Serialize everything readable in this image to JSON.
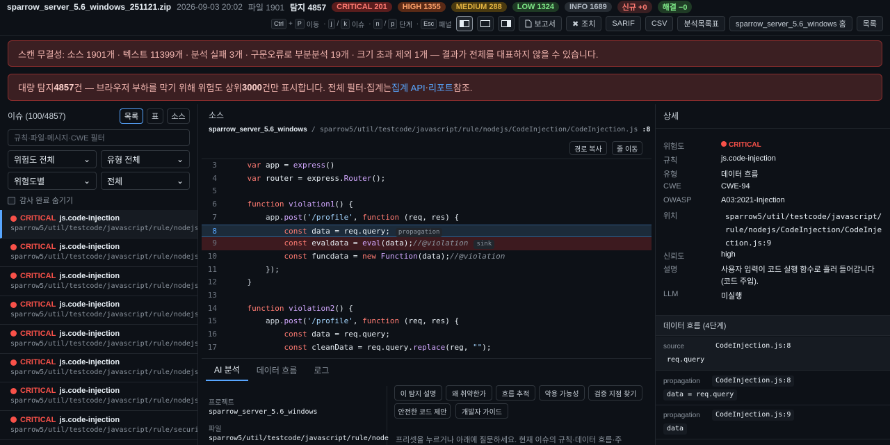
{
  "header": {
    "filename": "sparrow_server_5.6_windows_251121.zip",
    "datetime": "2026-09-03 20:02",
    "file_count_label": "파일 1901",
    "detect_label": "탐지",
    "detect_count": "4857",
    "badges": {
      "critical": "CRITICAL 201",
      "high": "HIGH 1355",
      "medium": "MEDIUM 288",
      "low": "LOW 1324",
      "info": "INFO 1689",
      "new": "신규 +0",
      "resolved": "해결 −0"
    },
    "badge_colors": {
      "critical": "#5a1d1d",
      "high": "#5a2a16",
      "medium": "#4a3a10",
      "low": "#1f3b25",
      "info": "#262c33",
      "new": "#3a1f22",
      "resolved": "#1f3b25"
    }
  },
  "toolbar": {
    "hint_nav": {
      "k1": "Ctrl",
      "plus": "+",
      "k2": "P",
      "label": "이동"
    },
    "hint_issue": {
      "k1": "j",
      "sep": "/",
      "k2": "k",
      "label": "이슈"
    },
    "hint_step": {
      "k1": "n",
      "sep": "/",
      "k2": "p",
      "label": "단계"
    },
    "hint_panel": {
      "k1": "Esc",
      "label": "패널"
    },
    "report": "보고서",
    "action": "조치",
    "sarif": "SARIF",
    "csv": "CSV",
    "analysis_list": "분석목록표",
    "project_home": "sparrow_server_5.6_windows 홈",
    "list": "목록"
  },
  "banners": {
    "integrity": "스캔 무결성: 소스 1901개 · 텍스트 11399개 · 분석 실패 3개 · 구문오류로 부분분석 19개 · 크기 초과 제외 1개 — 결과가 전체를 대표하지 않을 수 있습니다.",
    "bulk_a": "대량 탐지 ",
    "bulk_count": "4857",
    "bulk_b": "건 — 브라우저 부하를 막기 위해 위험도 상위 ",
    "bulk_top": "3000",
    "bulk_c": "건만 표시합니다. 전체 필터·집계는 ",
    "bulk_link1": "집계 API",
    "bulk_sep": " · ",
    "bulk_link2": "리포트",
    "bulk_d": " 참조."
  },
  "issues_panel": {
    "title": "이슈 (100/4857)",
    "view_list": "목록",
    "view_table": "표",
    "view_source": "소스",
    "filter_placeholder": "규칙·파일·메시지·CWE 필터",
    "severity_filter": "위험도 전체",
    "type_filter": "유형 전체",
    "group_by": "위험도별",
    "scope": "전체",
    "hide_reviewed": "감사 완료 숨기기",
    "items": [
      {
        "sev": "CRITICAL",
        "rule": "js.code-injection",
        "path": "sparrow5/util/testcode/javascript/rule/nodejs/C..."
      },
      {
        "sev": "CRITICAL",
        "rule": "js.code-injection",
        "path": "sparrow5/util/testcode/javascript/rule/nodejs/C..."
      },
      {
        "sev": "CRITICAL",
        "rule": "js.code-injection",
        "path": "sparrow5/util/testcode/javascript/rule/nodejs/C..."
      },
      {
        "sev": "CRITICAL",
        "rule": "js.code-injection",
        "path": "sparrow5/util/testcode/javascript/rule/nodejs/C..."
      },
      {
        "sev": "CRITICAL",
        "rule": "js.code-injection",
        "path": "sparrow5/util/testcode/javascript/rule/nodejs/C..."
      },
      {
        "sev": "CRITICAL",
        "rule": "js.code-injection",
        "path": "sparrow5/util/testcode/javascript/rule/nodejs/C..."
      },
      {
        "sev": "CRITICAL",
        "rule": "js.code-injection",
        "path": "sparrow5/util/testcode/javascript/rule/nodejs/C..."
      },
      {
        "sev": "CRITICAL",
        "rule": "js.code-injection",
        "path": "sparrow5/util/testcode/javascript/rule/security..."
      }
    ]
  },
  "source": {
    "title": "소스",
    "project": "sparrow_server_5.6_windows",
    "sep": " / ",
    "path": "sparrow5/util/testcode/javascript/rule/nodejs/CodeInjection/CodeInjection.js",
    "line_ref": ":8",
    "copy_path": "경로 복사",
    "goto_line": "줄 이동",
    "lines": [
      {
        "no": "3",
        "tokens": [
          [
            "",
            "    "
          ],
          [
            "kw",
            "var"
          ],
          [
            "vn",
            " app = "
          ],
          [
            "fn",
            "express"
          ],
          [
            "vn",
            "()"
          ]
        ]
      },
      {
        "no": "4",
        "tokens": [
          [
            "",
            "    "
          ],
          [
            "kw",
            "var"
          ],
          [
            "vn",
            " router = express."
          ],
          [
            "fn",
            "Router"
          ],
          [
            "vn",
            "();"
          ]
        ]
      },
      {
        "no": "5",
        "tokens": []
      },
      {
        "no": "6",
        "tokens": [
          [
            "",
            "    "
          ],
          [
            "kw",
            "function"
          ],
          [
            "vn",
            " "
          ],
          [
            "fn",
            "violation1"
          ],
          [
            "vn",
            "() {"
          ]
        ]
      },
      {
        "no": "7",
        "tokens": [
          [
            "",
            "        app."
          ],
          [
            "fn",
            "post"
          ],
          [
            "vn",
            "("
          ],
          [
            "st",
            "'/profile'"
          ],
          [
            "vn",
            ", "
          ],
          [
            "kw",
            "function"
          ],
          [
            "vn",
            " (req, res) {"
          ]
        ]
      },
      {
        "no": "8",
        "hl": "prop",
        "tokens": [
          [
            "",
            "            "
          ],
          [
            "kw",
            "const"
          ],
          [
            "vn",
            " data = req.query;"
          ]
        ],
        "tag": "propagation"
      },
      {
        "no": "9",
        "hl": "sink",
        "tokens": [
          [
            "",
            "            "
          ],
          [
            "kw",
            "const"
          ],
          [
            "vn",
            " evaldata = "
          ],
          [
            "fn",
            "eval"
          ],
          [
            "vn",
            "(data);"
          ],
          [
            "cm",
            "//@violation"
          ]
        ],
        "tag": "sink"
      },
      {
        "no": "10",
        "tokens": [
          [
            "",
            "            "
          ],
          [
            "kw",
            "const"
          ],
          [
            "vn",
            " funcdata = "
          ],
          [
            "kw",
            "new"
          ],
          [
            "vn",
            " "
          ],
          [
            "fn",
            "Function"
          ],
          [
            "vn",
            "(data);"
          ],
          [
            "cm",
            "//@violation"
          ]
        ]
      },
      {
        "no": "11",
        "tokens": [
          [
            "",
            "        });"
          ]
        ]
      },
      {
        "no": "12",
        "tokens": [
          [
            "",
            "    }"
          ]
        ]
      },
      {
        "no": "13",
        "tokens": []
      },
      {
        "no": "14",
        "tokens": [
          [
            "",
            "    "
          ],
          [
            "kw",
            "function"
          ],
          [
            "vn",
            " "
          ],
          [
            "fn",
            "violation2"
          ],
          [
            "vn",
            "() {"
          ]
        ]
      },
      {
        "no": "15",
        "tokens": [
          [
            "",
            "        app."
          ],
          [
            "fn",
            "post"
          ],
          [
            "vn",
            "("
          ],
          [
            "st",
            "'/profile'"
          ],
          [
            "vn",
            ", "
          ],
          [
            "kw",
            "function"
          ],
          [
            "vn",
            " (req, res) {"
          ]
        ]
      },
      {
        "no": "16",
        "tokens": [
          [
            "",
            "            "
          ],
          [
            "kw",
            "const"
          ],
          [
            "vn",
            " data = req.query;"
          ]
        ]
      },
      {
        "no": "17",
        "tokens": [
          [
            "",
            "            "
          ],
          [
            "kw",
            "const"
          ],
          [
            "vn",
            " cleanData = req.query."
          ],
          [
            "fn",
            "replace"
          ],
          [
            "vn",
            "(reg, "
          ],
          [
            "st",
            "\"\""
          ],
          [
            "vn",
            ");"
          ]
        ]
      }
    ]
  },
  "bottom_tabs": {
    "ai": "AI 분석",
    "flow": "데이터 흐름",
    "log": "로그"
  },
  "ai": {
    "project_label": "프로젝트",
    "project_value": "sparrow_server_5.6_windows",
    "file_label": "파일",
    "file_value": "sparrow5/util/testcode/javascript/rule/node",
    "chips": [
      "이 탐지 설명",
      "왜 취약한가",
      "흐름 추적",
      "악용 가능성",
      "검증 지점 찾기",
      "안전한 코드 제안",
      "개발자 가이드"
    ],
    "prompt": "프리셋을 누르거나 아래에 질문하세요. 현재 이슈의 규칙·데이터 흐름·주"
  },
  "detail": {
    "title": "상세",
    "severity_label": "위험도",
    "severity_value": "CRITICAL",
    "rule_label": "규칙",
    "rule_value": "js.code-injection",
    "type_label": "유형",
    "type_value": "데이터 흐름",
    "cwe_label": "CWE",
    "cwe_value": "CWE-94",
    "owasp_label": "OWASP",
    "owasp_value": "A03:2021-Injection",
    "location_label": "위치",
    "location_value": "sparrow5/util/testcode/javascript/rule/nodejs/CodeInjection/CodeInjection.js:9",
    "confidence_label": "신뢰도",
    "confidence_value": "high",
    "desc_label": "설명",
    "desc_value": "사용자 입력이 코드 실행 함수로 흘러 들어갑니다 (코드 주입).",
    "llm_label": "LLM",
    "llm_value": "미실행"
  },
  "flow": {
    "title": "데이터 흐름 (4단계)",
    "steps": [
      {
        "kind": "source",
        "file": "CodeInjection.js:8",
        "code": "req.query"
      },
      {
        "kind": "propagation",
        "file": "CodeInjection.js:8",
        "code": "data = req.query"
      },
      {
        "kind": "propagation",
        "file": "CodeInjection.js:9",
        "code": "data"
      }
    ]
  }
}
